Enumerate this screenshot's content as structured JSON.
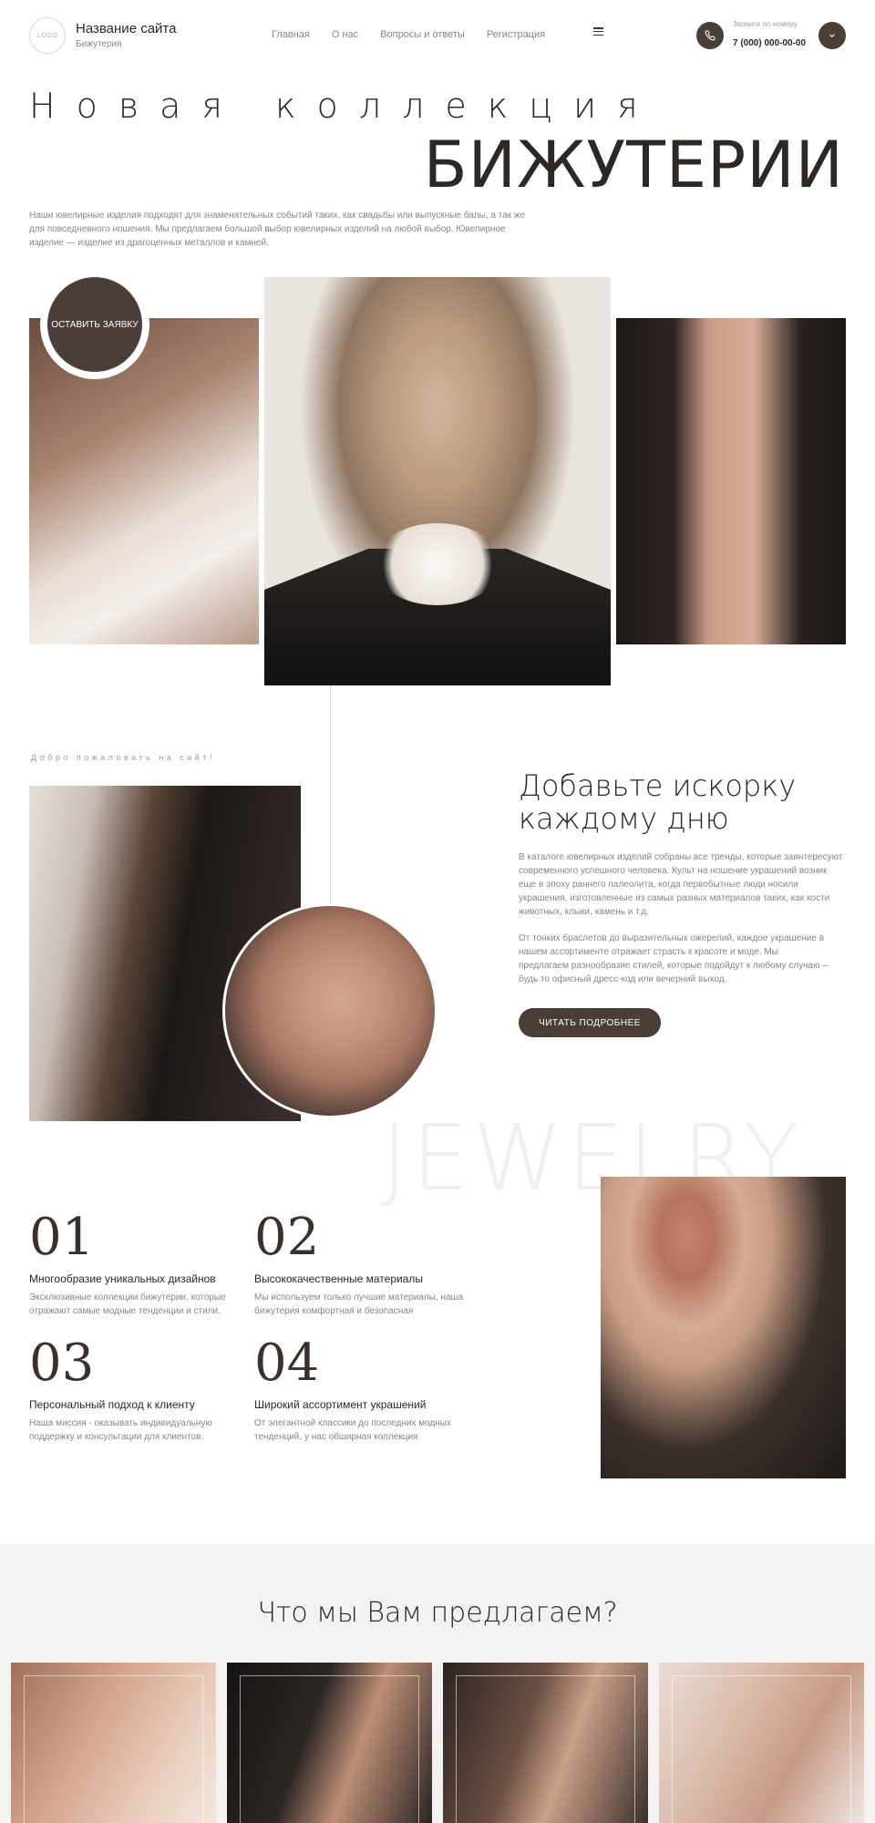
{
  "header": {
    "logo": "LOGO",
    "site_title": "Название сайта",
    "site_subtitle": "Бижутерия",
    "nav": [
      "Главная",
      "О нас",
      "Вопросы и ответы",
      "Регистрация"
    ],
    "call_label": "Звоните по номеру",
    "call_number": "7 (000) 000-00-00"
  },
  "hero": {
    "line1": "Новая коллекция",
    "line2": "БИЖУТЕРИИ",
    "description": "Наши ювелирные изделия подходят для знаменательных событий таких, как свадьбы или выпускные балы, а так же для повседневного ношения. Мы предлагаем большой выбор ювелирных изделий на любой выбор. Ювелирное изделие — изделие из драгоценных металлов и камней.",
    "cta": "Оставить заявку"
  },
  "welcome": {
    "label": "Добро пожаловать на сайт!",
    "title": "Добавьте искорку каждому дню",
    "p1": "В каталоге ювелирных изделий собраны все тренды, которые заинтересуют современного успешного человека. Культ на ношение украшений возник еще в эпоху раннего палеолита, когда первобытные люди носили украшения, изготовленные из самых разных материалов таких, как кости животных, клыки, камень и т.д.",
    "p2": "От тонких браслетов до выразительных ожерелий, каждое украшение в нашем ассортименте отражает страсть к красоте и моде. Мы предлагаем разнообразие стилей, которые подойдут к любому случаю – будь то офисный дресс-код или вечерний выход.",
    "button": "Читать подробнее",
    "watermark": "JEWELRY"
  },
  "features": [
    {
      "num": "01",
      "title": "Многообразие уникальных дизайнов",
      "desc": "Эксклюзивные коллекции бижутерии, которые отражают самые модные тенденции и стили."
    },
    {
      "num": "02",
      "title": "Высококачественные материалы",
      "desc": "Мы используем только лучшие материалы, наша бижутерия комфортная и безопасная"
    },
    {
      "num": "03",
      "title": "Персональный подход к клиенту",
      "desc": "Наша миссия - оказывать индивидуальную поддержку и консультации для клиентов."
    },
    {
      "num": "04",
      "title": "Широкий ассортимент украшений",
      "desc": "От элегантной классики до последних модных тенденций, у нас обширная коллекция"
    }
  ],
  "offers": {
    "title": "Что мы Вам предлагаем?"
  },
  "colors": {
    "accent": "#4a3e39",
    "text": "#2b2826",
    "muted": "#8c8480",
    "offers_bg": "#f3f2f1"
  }
}
